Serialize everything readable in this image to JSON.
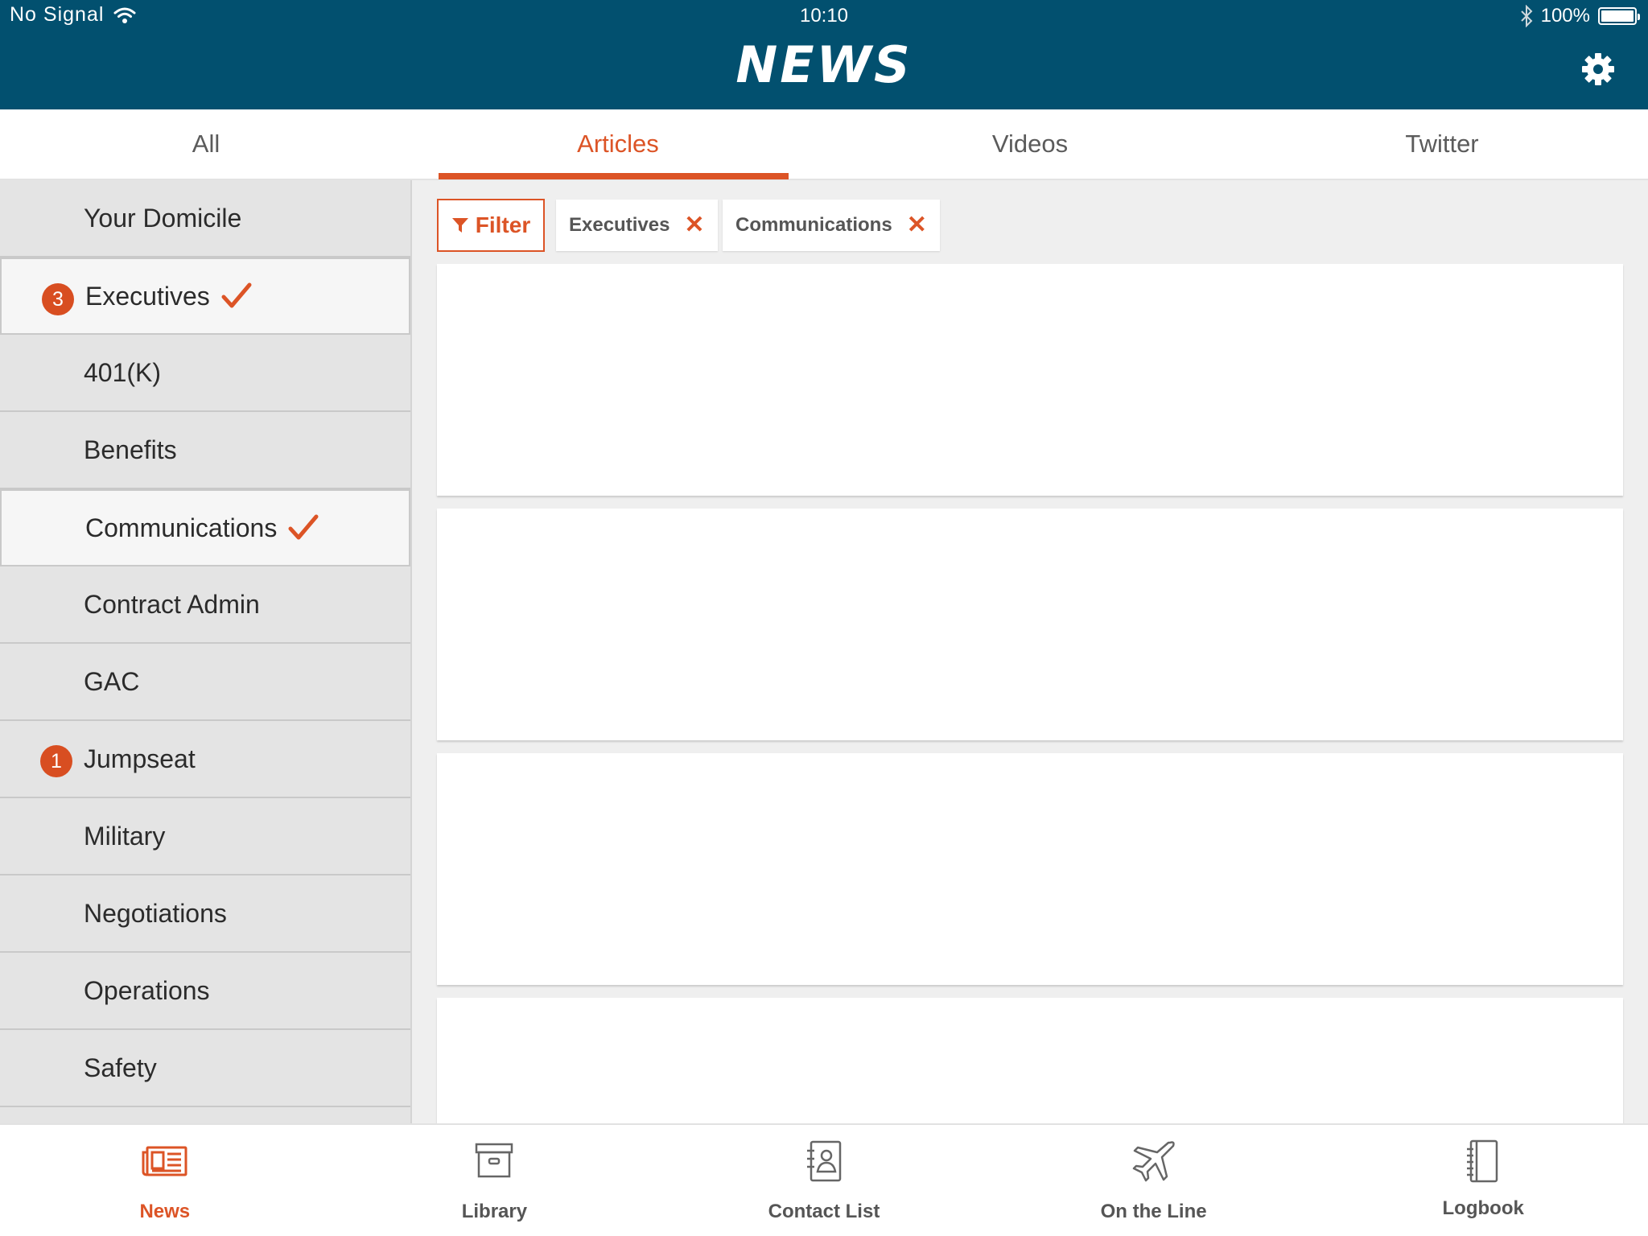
{
  "status_bar": {
    "carrier": "No Signal",
    "time": "10:10",
    "battery": "100%"
  },
  "header": {
    "title": "NEWS"
  },
  "tabs": [
    {
      "label": "All",
      "active": false
    },
    {
      "label": "Articles",
      "active": true
    },
    {
      "label": "Videos",
      "active": false
    },
    {
      "label": "Twitter",
      "active": false
    }
  ],
  "sidebar": {
    "items": [
      {
        "label": "Your Domicile"
      },
      {
        "label": "Executives",
        "badge": "3",
        "checked": true
      },
      {
        "label": "401(K)"
      },
      {
        "label": "Benefits"
      },
      {
        "label": "Communications",
        "checked": true
      },
      {
        "label": "Contract Admin"
      },
      {
        "label": "GAC"
      },
      {
        "label": "Jumpseat",
        "badge": "1"
      },
      {
        "label": "Military"
      },
      {
        "label": "Negotiations"
      },
      {
        "label": "Operations"
      },
      {
        "label": "Safety"
      }
    ]
  },
  "filter": {
    "button_label": "Filter",
    "chips": [
      {
        "label": "Executives",
        "remove": "✕"
      },
      {
        "label": "Communications",
        "remove": "✕"
      }
    ]
  },
  "bottom_nav": [
    {
      "label": "News",
      "icon": "newspaper-icon",
      "active": true
    },
    {
      "label": "Library",
      "icon": "archive-box-icon",
      "active": false
    },
    {
      "label": "Contact List",
      "icon": "contact-book-icon",
      "active": false
    },
    {
      "label": "On the Line",
      "icon": "airplane-icon",
      "active": false
    },
    {
      "label": "Logbook",
      "icon": "notebook-icon",
      "active": false
    }
  ],
  "colors": {
    "header_bg": "#02506f",
    "accent": "#dc5426"
  }
}
